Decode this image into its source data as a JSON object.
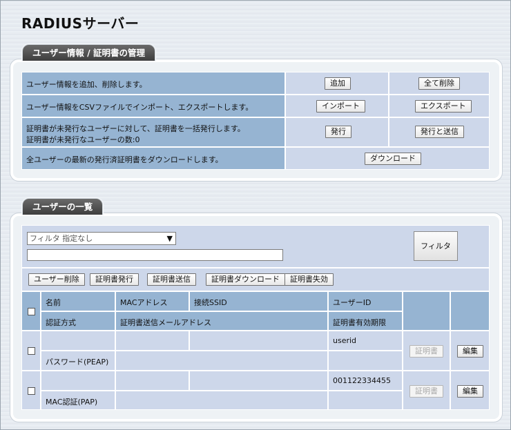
{
  "page": {
    "title": "RADIUSサーバー"
  },
  "user_info": {
    "tab_label": "ユーザー情報 / 証明書の管理",
    "rows": [
      {
        "text": "ユーザー情報を追加、削除します。",
        "btn1": "追加",
        "btn2": "全て削除"
      },
      {
        "text": "ユーザー情報をCSVファイルでインポート、エクスポートします。",
        "btn1": "インポート",
        "btn2": "エクスポート"
      },
      {
        "text": "証明書が未発行なユーザーに対して、証明書を一括発行します。",
        "text2": "証明書が未発行なユーザーの数:0",
        "btn1": "発行",
        "btn2": "発行と送信"
      },
      {
        "text": "全ユーザーの最新の発行済証明書をダウンロードします。",
        "btn1": "ダウンロード"
      }
    ]
  },
  "user_list": {
    "tab_label": "ユーザーの一覧",
    "filter": {
      "selected": "フィルタ 指定なし",
      "text_value": "",
      "button": "フィルタ"
    },
    "actions": [
      "ユーザー削除",
      "証明書発行",
      "証明書送信",
      "証明書ダウンロード",
      "証明書失効"
    ],
    "headers": {
      "name": "名前",
      "mac": "MACアドレス",
      "ssid": "接続SSID",
      "user_id": "ユーザーID",
      "auth": "認証方式",
      "cert_mail": "証明書送信メールアドレス",
      "cert_expiry": "証明書有効期限"
    },
    "users": [
      {
        "name": "",
        "mac": "",
        "ssid": "",
        "user_id": "userid",
        "auth": "パスワード(PEAP)",
        "cert_mail": "",
        "cert_expiry": "",
        "cert_btn": "証明書",
        "edit_btn": "編集"
      },
      {
        "name": "",
        "mac": "",
        "ssid": "",
        "user_id": "001122334455",
        "auth": "MAC認証(PAP)",
        "cert_mail": "",
        "cert_expiry": "",
        "cert_btn": "証明書",
        "edit_btn": "編集"
      }
    ]
  }
}
